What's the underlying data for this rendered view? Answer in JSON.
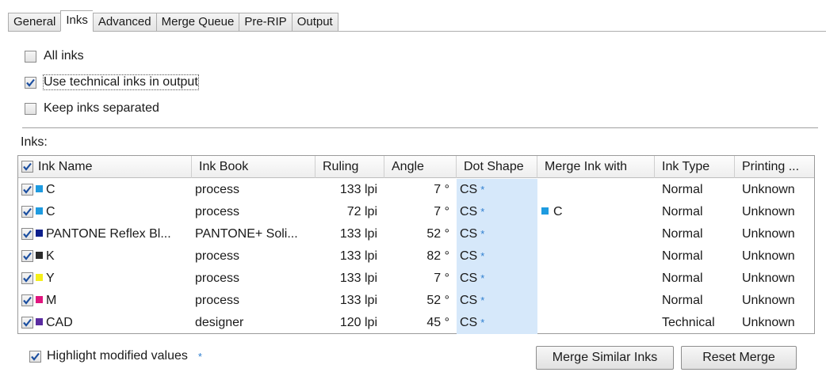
{
  "tabs": [
    {
      "label": "General",
      "active": false
    },
    {
      "label": "Inks",
      "active": true
    },
    {
      "label": "Advanced",
      "active": false
    },
    {
      "label": "Merge Queue",
      "active": false
    },
    {
      "label": "Pre-RIP",
      "active": false
    },
    {
      "label": "Output",
      "active": false
    }
  ],
  "options": {
    "all_inks": {
      "label": "All inks",
      "checked": false
    },
    "use_technical": {
      "label": "Use technical inks in output",
      "checked": true
    },
    "keep_separated": {
      "label": "Keep inks separated",
      "checked": false
    }
  },
  "inks_label": "Inks:",
  "table": {
    "columns": [
      "Ink Name",
      "Ink Book",
      "Ruling",
      "Angle",
      "Dot Shape",
      "Merge Ink with",
      "Ink Type",
      "Printing ..."
    ],
    "rows": [
      {
        "checked": true,
        "swatch": "#1e9be0",
        "name": "C",
        "book": "process",
        "ruling": "133 lpi",
        "angle": "7 °",
        "dot": "CS",
        "dot_mark": "*",
        "merge": "",
        "merge_swatch": "",
        "type": "Normal",
        "printing": "Unknown"
      },
      {
        "checked": true,
        "swatch": "#1e9be0",
        "name": "C",
        "book": "process",
        "ruling": "72 lpi",
        "angle": "7 °",
        "dot": "CS",
        "dot_mark": "*",
        "merge": "C",
        "merge_swatch": "#1e9be0",
        "type": "Normal",
        "printing": "Unknown"
      },
      {
        "checked": true,
        "swatch": "#0d1f8c",
        "name": "PANTONE Reflex Bl...",
        "book": "PANTONE+ Soli...",
        "ruling": "133 lpi",
        "angle": "52 °",
        "dot": "CS",
        "dot_mark": "*",
        "merge": "",
        "merge_swatch": "",
        "type": "Normal",
        "printing": "Unknown"
      },
      {
        "checked": true,
        "swatch": "#2b2b2b",
        "name": "K",
        "book": "process",
        "ruling": "133 lpi",
        "angle": "82 °",
        "dot": "CS",
        "dot_mark": "*",
        "merge": "",
        "merge_swatch": "",
        "type": "Normal",
        "printing": "Unknown"
      },
      {
        "checked": true,
        "swatch": "#f5ef1a",
        "name": "Y",
        "book": "process",
        "ruling": "133 lpi",
        "angle": "7 °",
        "dot": "CS",
        "dot_mark": "*",
        "merge": "",
        "merge_swatch": "",
        "type": "Normal",
        "printing": "Unknown"
      },
      {
        "checked": true,
        "swatch": "#e0157e",
        "name": "M",
        "book": "process",
        "ruling": "133 lpi",
        "angle": "52 °",
        "dot": "CS",
        "dot_mark": "*",
        "merge": "",
        "merge_swatch": "",
        "type": "Normal",
        "printing": "Unknown"
      },
      {
        "checked": true,
        "swatch": "#5a2ba0",
        "name": "CAD",
        "book": "designer",
        "ruling": "120 lpi",
        "angle": "45 °",
        "dot": "CS",
        "dot_mark": "*",
        "merge": "",
        "merge_swatch": "",
        "type": "Technical",
        "printing": "Unknown"
      }
    ]
  },
  "highlight": {
    "label": "Highlight modified values",
    "mark": "*",
    "checked": true
  },
  "buttons": {
    "merge_similar": "Merge Similar Inks",
    "reset_merge": "Reset Merge"
  },
  "colors": {
    "checkmark": "#1c4fa0",
    "dot_shape_bg": "#d6e8fa",
    "star": "#2f7fd0"
  }
}
